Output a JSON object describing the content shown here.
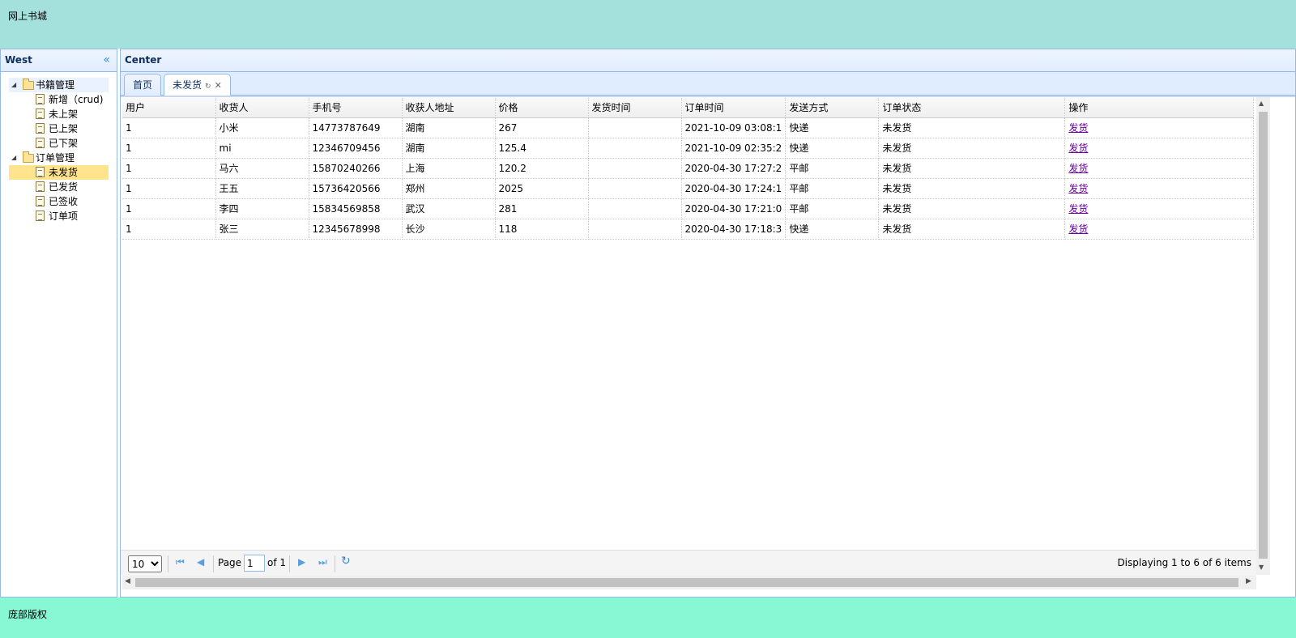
{
  "header": {
    "title": "网上书城"
  },
  "footer": {
    "copyright": "庞部版权"
  },
  "west": {
    "title": "West",
    "tree": {
      "book_mgmt": {
        "label": "书籍管理",
        "children": [
          "新增（crud)",
          "未上架",
          "已上架",
          "已下架"
        ]
      },
      "order_mgmt": {
        "label": "订单管理",
        "children": [
          "未发货",
          "已发货",
          "已签收",
          "订单项"
        ]
      }
    }
  },
  "center": {
    "title": "Center",
    "tabs": [
      {
        "label": "首页"
      },
      {
        "label": "未发货"
      }
    ]
  },
  "grid": {
    "columns": [
      "用户",
      "收货人",
      "手机号",
      "收获人地址",
      "价格",
      "发货时间",
      "订单时间",
      "发送方式",
      "订单状态",
      "操作"
    ],
    "rows": [
      [
        "1",
        "小米",
        "14773787649",
        "湖南",
        "267",
        "",
        "2021-10-09 03:08:1",
        "快递",
        "未发货",
        "发货"
      ],
      [
        "1",
        "mi",
        "12346709456",
        "湖南",
        "125.4",
        "",
        "2021-10-09 02:35:2",
        "快递",
        "未发货",
        "发货"
      ],
      [
        "1",
        "马六",
        "15870240266",
        "上海",
        "120.2",
        "",
        "2020-04-30 17:27:2",
        "平邮",
        "未发货",
        "发货"
      ],
      [
        "1",
        "王五",
        "15736420566",
        "郑州",
        "2025",
        "",
        "2020-04-30 17:24:1",
        "平邮",
        "未发货",
        "发货"
      ],
      [
        "1",
        "李四",
        "15834569858",
        "武汉",
        "281",
        "",
        "2020-04-30 17:21:0",
        "平邮",
        "未发货",
        "发货"
      ],
      [
        "1",
        "张三",
        "12345678998",
        "长沙",
        "118",
        "",
        "2020-04-30 17:18:3",
        "快递",
        "未发货",
        "发货"
      ]
    ]
  },
  "pager": {
    "page_size": "10",
    "page_label": "Page",
    "page_value": "1",
    "of_label": "of 1",
    "info": "Displaying 1 to 6 of 6 items"
  },
  "colors": {
    "north": "#a4e0dc",
    "south": "#88f7d4",
    "tree_selected": "#ffe48d",
    "link": "#660099"
  }
}
